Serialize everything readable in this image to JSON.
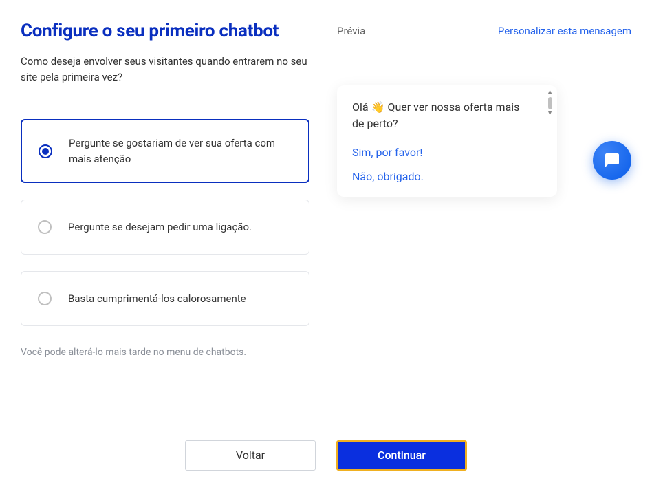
{
  "header": {
    "title": "Configure o seu primeiro chatbot",
    "subtitle": "Como deseja envolver seus visitantes quando entrarem no seu site pela primeira vez?"
  },
  "options": [
    {
      "label": "Pergunte se gostariam de ver sua oferta com mais atenção",
      "selected": true
    },
    {
      "label": "Pergunte se desejam pedir uma ligação.",
      "selected": false
    },
    {
      "label": "Basta cumprimentá-los calorosamente",
      "selected": false
    }
  ],
  "hint": "Você pode alterá-lo mais tarde no menu de chatbots.",
  "preview": {
    "label": "Prévia",
    "customize_link": "Personalizar esta mensagem",
    "greeting_prefix": "Olá ",
    "greeting_emoji": "👋",
    "greeting_suffix": " Quer ver nossa oferta mais de perto?",
    "reply_yes": "Sim, por favor!",
    "reply_no": "Não, obrigado."
  },
  "footer": {
    "back": "Voltar",
    "continue": "Continuar"
  }
}
